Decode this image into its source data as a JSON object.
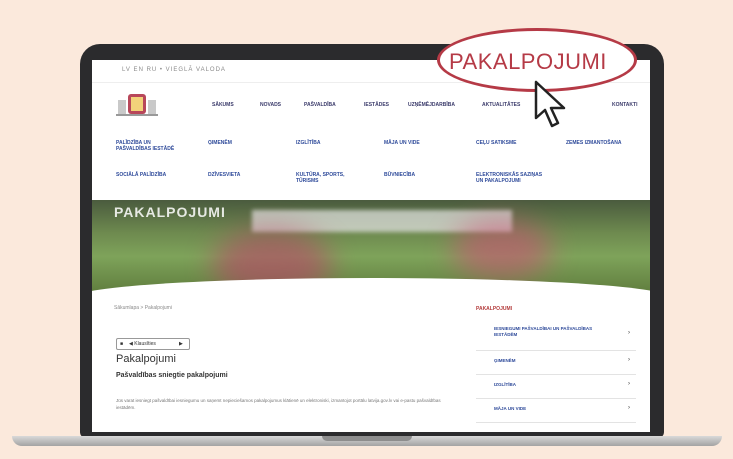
{
  "callout": {
    "label": "PAKALPOJUMI"
  },
  "site": {
    "lang_bar": "LV  EN  RU  •  VIEGLĀ VALODA",
    "nav": [
      "SĀKUMS",
      "NOVADS",
      "PAŠVALDĪBA",
      "IESTĀDES",
      "UZŅĒMĒJDARBĪBA",
      "AKTUALITĀTES",
      "KONTAKTI"
    ],
    "menu": [
      [
        "ĢIMENĒM",
        "PALĪDZĪBA UN",
        "PAŠVALDĪBAS IESTĀDĒ"
      ],
      [
        "IZGLĪTĪBA"
      ],
      [
        "BŪVNIECĪBA"
      ],
      [
        "MĀJA UN VIDE"
      ],
      [
        "CEĻU SATIKSME"
      ],
      [
        "SOCIĀLĀ PALĪDZĪBA"
      ],
      [
        "KULTŪRA, SPORTS, TŪRISMS"
      ],
      [
        "DZĪVESVIETA"
      ],
      [
        "ELEKTRONISKĀS SAZIŅAS",
        "UN PAKALPOJUMI"
      ],
      [
        "ZEMES IZMANTOŠANA"
      ]
    ],
    "hero_title": "PAKALPOJUMI",
    "breadcrumb": "Sākumlapa > Pakalpojumi",
    "tools": {
      "prev_label": "◀  Klausīties",
      "play_label": "▶"
    },
    "page_title": "Pakalpojumi",
    "subtitle": "Pašvaldības sniegtie pakalpojumi",
    "body_text": "Jūs varat iesniegt pašvaldībai iesniegumu un saņemt nepieciešamos pakalpojumus klātienē un elektroniski, izmantojot portālu latvija.gov.lv vai e-pastu pašvaldības iestādēm."
  },
  "sidebar": {
    "heading": "PAKALPOJUMI",
    "items": [
      {
        "label": "IESNIEGUMI PAŠVALDĪBAI UN PAŠVALDĪBAS IESTĀDĒM"
      },
      {
        "label": "ĢIMENĒM"
      },
      {
        "label": "IZGLĪTĪBA"
      },
      {
        "label": "MĀJA UN VIDE"
      }
    ],
    "chevron": "›"
  },
  "icons": [
    "crest-logo-icon",
    "cursor-arrow-icon",
    "speaker-icon",
    "chevron-right-icon"
  ]
}
